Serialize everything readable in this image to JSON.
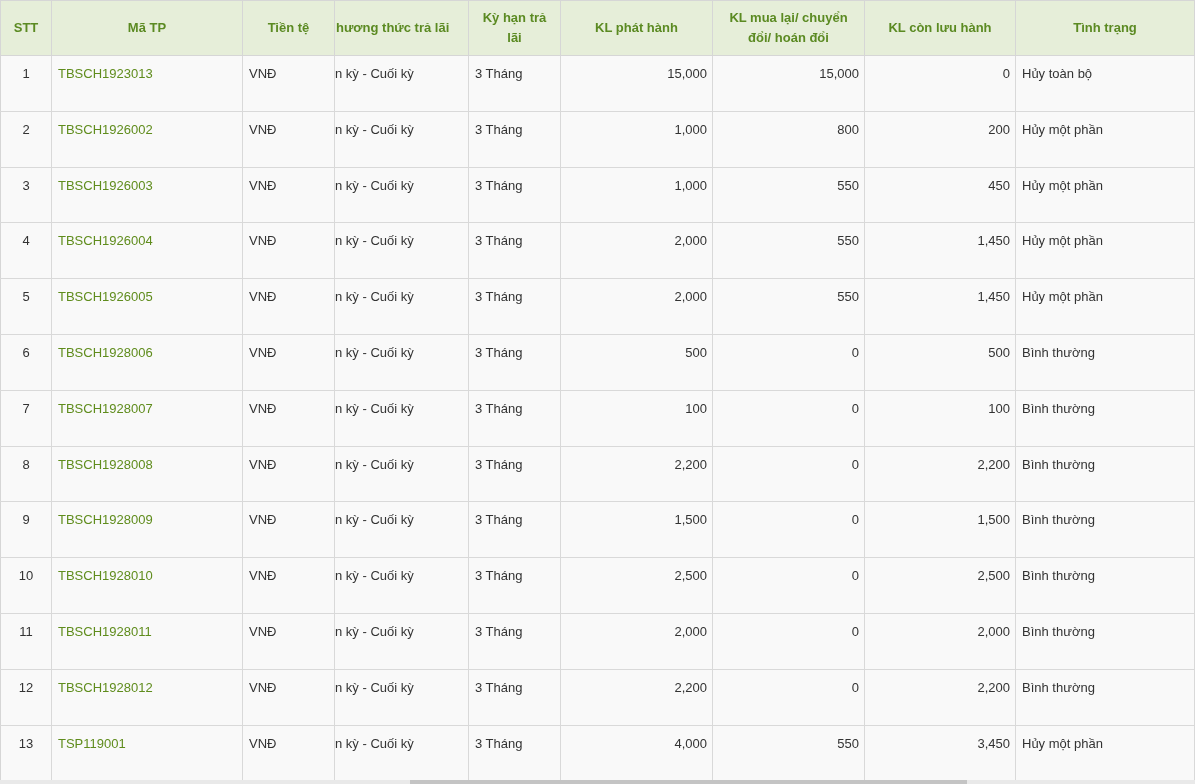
{
  "table": {
    "columns": [
      {
        "label": "STT",
        "kind": "index"
      },
      {
        "label": "Mã TP",
        "kind": "link"
      },
      {
        "label": "Tiền tệ",
        "kind": "text"
      },
      {
        "label": "hương thức trả lãi",
        "kind": "cut"
      },
      {
        "label": "Kỳ hạn trả lãi",
        "kind": "text"
      },
      {
        "label": "KL phát hành",
        "kind": "number"
      },
      {
        "label": "KL mua lại/ chuyển đổi/ hoán đổi",
        "kind": "number"
      },
      {
        "label": "KL còn lưu hành",
        "kind": "number"
      },
      {
        "label": "Tình trạng",
        "kind": "text"
      }
    ],
    "rows": [
      {
        "cells": [
          "1",
          "TBSCH1923013",
          "VNĐ",
          "n kỳ - Cuối kỳ",
          "3 Tháng",
          "15,000",
          "15,000",
          "0",
          "Hủy toàn bộ"
        ]
      },
      {
        "cells": [
          "2",
          "TBSCH1926002",
          "VNĐ",
          "n kỳ - Cuối kỳ",
          "3 Tháng",
          "1,000",
          "800",
          "200",
          "Hủy một phần"
        ]
      },
      {
        "cells": [
          "3",
          "TBSCH1926003",
          "VNĐ",
          "n kỳ - Cuối kỳ",
          "3 Tháng",
          "1,000",
          "550",
          "450",
          "Hủy một phần"
        ]
      },
      {
        "cells": [
          "4",
          "TBSCH1926004",
          "VNĐ",
          "n kỳ - Cuối kỳ",
          "3 Tháng",
          "2,000",
          "550",
          "1,450",
          "Hủy một phần"
        ]
      },
      {
        "cells": [
          "5",
          "TBSCH1926005",
          "VNĐ",
          "n kỳ - Cuối kỳ",
          "3 Tháng",
          "2,000",
          "550",
          "1,450",
          "Hủy một phần"
        ]
      },
      {
        "cells": [
          "6",
          "TBSCH1928006",
          "VNĐ",
          "n kỳ - Cuối kỳ",
          "3 Tháng",
          "500",
          "0",
          "500",
          "Bình thường"
        ]
      },
      {
        "cells": [
          "7",
          "TBSCH1928007",
          "VNĐ",
          "n kỳ - Cuối kỳ",
          "3 Tháng",
          "100",
          "0",
          "100",
          "Bình thường"
        ]
      },
      {
        "cells": [
          "8",
          "TBSCH1928008",
          "VNĐ",
          "n kỳ - Cuối kỳ",
          "3 Tháng",
          "2,200",
          "0",
          "2,200",
          "Bình thường"
        ]
      },
      {
        "cells": [
          "9",
          "TBSCH1928009",
          "VNĐ",
          "n kỳ - Cuối kỳ",
          "3 Tháng",
          "1,500",
          "0",
          "1,500",
          "Bình thường"
        ]
      },
      {
        "cells": [
          "10",
          "TBSCH1928010",
          "VNĐ",
          "n kỳ - Cuối kỳ",
          "3 Tháng",
          "2,500",
          "0",
          "2,500",
          "Bình thường"
        ]
      },
      {
        "cells": [
          "11",
          "TBSCH1928011",
          "VNĐ",
          "n kỳ - Cuối kỳ",
          "3 Tháng",
          "2,000",
          "0",
          "2,000",
          "Bình thường"
        ]
      },
      {
        "cells": [
          "12",
          "TBSCH1928012",
          "VNĐ",
          "n kỳ - Cuối kỳ",
          "3 Tháng",
          "2,200",
          "0",
          "2,200",
          "Bình thường"
        ]
      },
      {
        "cells": [
          "13",
          "TSP119001",
          "VNĐ",
          "n kỳ - Cuối kỳ",
          "3 Tháng",
          "4,000",
          "550",
          "3,450",
          "Hủy một phần"
        ]
      }
    ]
  }
}
